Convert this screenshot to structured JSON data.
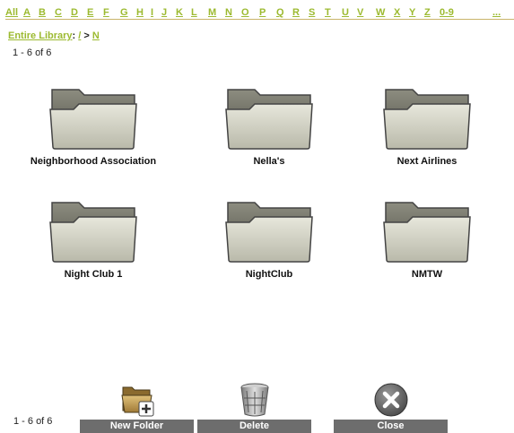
{
  "alpha_nav": [
    "All",
    "A",
    "B",
    "C",
    "D",
    "E",
    "F",
    "G",
    "H",
    "I",
    "J",
    "K",
    "L",
    "M",
    "N",
    "O",
    "P",
    "Q",
    "R",
    "S",
    "T",
    "U",
    "V",
    "W",
    "X",
    "Y",
    "Z",
    "0-9",
    "..."
  ],
  "breadcrumb": {
    "root": "Entire Library",
    "sep1": ":",
    "slash": "/",
    "sep2": ">",
    "current": "N"
  },
  "pagination": {
    "top": "1 - 6 of 6",
    "bottom": "1 - 6 of 6"
  },
  "folders": [
    {
      "name": "Neighborhood Association",
      "icon": "folder-icon"
    },
    {
      "name": "Nella's",
      "icon": "folder-icon"
    },
    {
      "name": "Next Airlines",
      "icon": "folder-icon"
    },
    {
      "name": "Night Club 1",
      "icon": "folder-icon"
    },
    {
      "name": "NightClub",
      "icon": "folder-icon"
    },
    {
      "name": "NMTW",
      "icon": "folder-icon"
    }
  ],
  "actions": {
    "new_folder": {
      "label": "New Folder",
      "icon": "new-folder-icon"
    },
    "delete": {
      "label": "Delete",
      "icon": "trash-icon"
    },
    "close": {
      "label": "Close",
      "icon": "close-icon"
    }
  },
  "colors": {
    "link": "#9cba30",
    "action_bar": "#6d6d6d",
    "divider": "#c9b46a"
  }
}
